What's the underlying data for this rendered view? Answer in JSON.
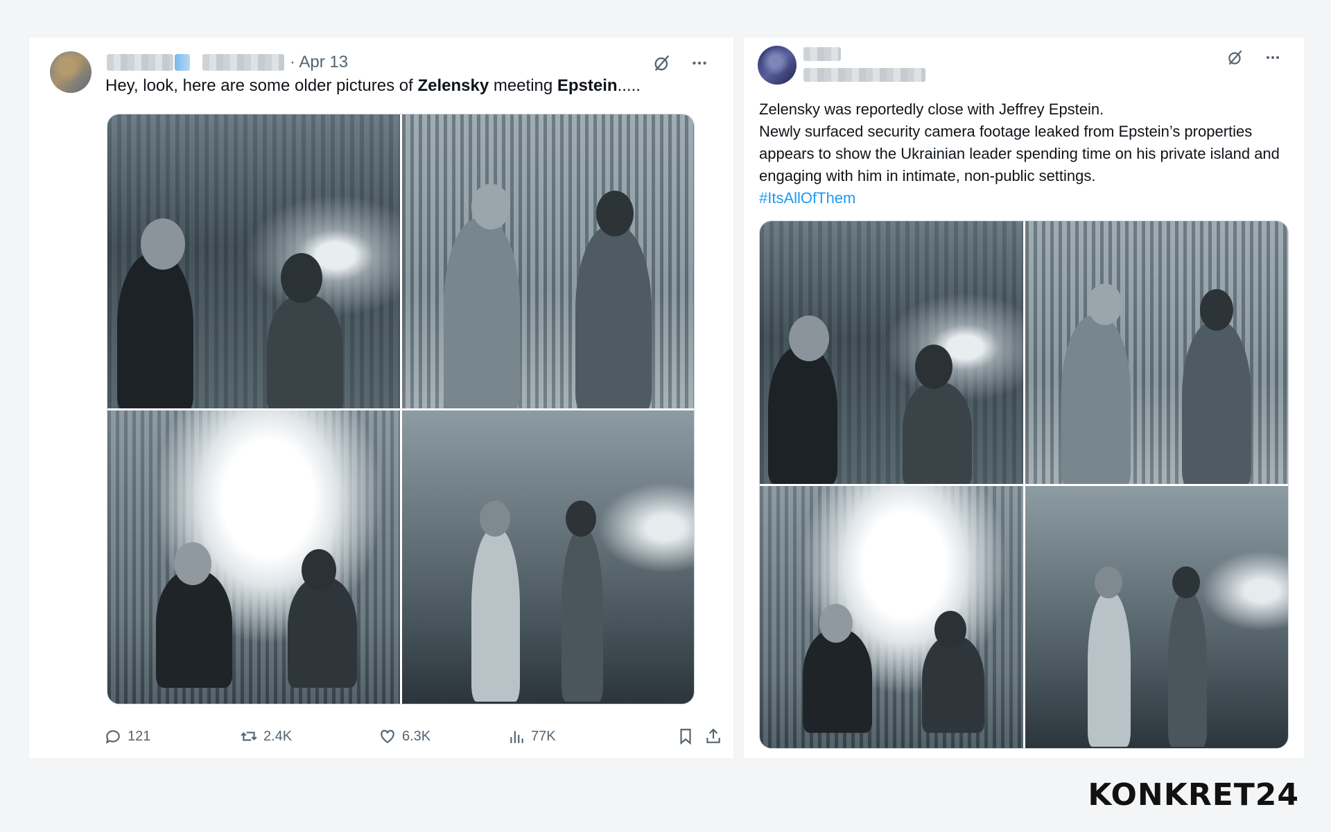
{
  "post1": {
    "date": "· Apr 13",
    "text_prefix": "Hey, look, here are some older pictures of ",
    "bold1": "Zelensky",
    "text_middle": " meeting ",
    "bold2": "Epstein",
    "text_suffix": ".....",
    "stats": {
      "replies": "121",
      "reposts": "2.4K",
      "likes": "6.3K",
      "views": "77K"
    }
  },
  "post2": {
    "line1": "Zelensky was reportedly close with Jeffrey Epstein.",
    "line2": "Newly surfaced security camera footage leaked from Epstein’s properties appears to show the Ukrainian leader spending time on his private island and engaging with him in intimate, non-public settings.",
    "hashtag": "#ItsAllOfThem"
  },
  "watermark": "KONKRET24",
  "colors": {
    "link": "#1d9bf0",
    "muted": "#536471",
    "text": "#0f1419"
  },
  "icons": [
    "grok-icon",
    "more-icon",
    "reply-icon",
    "repost-icon",
    "like-icon",
    "views-icon",
    "bookmark-icon",
    "share-icon"
  ]
}
